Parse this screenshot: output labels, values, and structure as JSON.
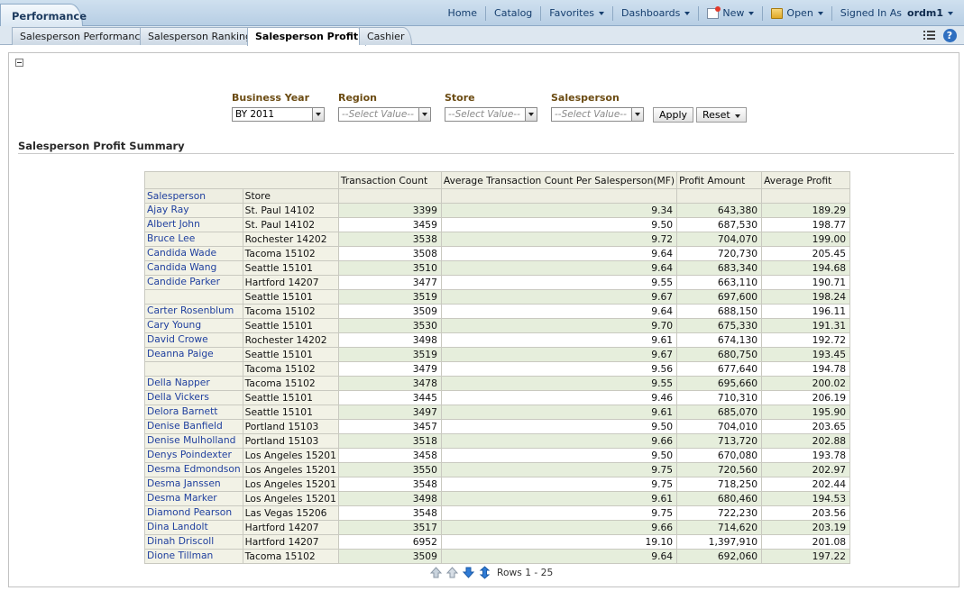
{
  "header": {
    "app_tab": "Performance",
    "nav": {
      "home": "Home",
      "catalog": "Catalog",
      "favorites": "Favorites",
      "dashboards": "Dashboards",
      "new": "New",
      "open": "Open",
      "signed_in_as": "Signed In As",
      "user": "ordm1"
    }
  },
  "tabs": [
    "Salesperson Performance",
    "Salesperson Ranking",
    "Salesperson Profit",
    "Cashier"
  ],
  "active_tab": "Salesperson Profit",
  "prompts": {
    "business_year": {
      "label": "Business Year",
      "value": "BY 2011"
    },
    "region": {
      "label": "Region",
      "placeholder": "--Select Value--"
    },
    "store": {
      "label": "Store",
      "placeholder": "--Select Value--"
    },
    "salesperson": {
      "label": "Salesperson",
      "placeholder": "--Select Value--"
    },
    "apply": "Apply",
    "reset": "Reset"
  },
  "report": {
    "title": "Salesperson Profit Summary",
    "columns": {
      "salesperson": "Salesperson",
      "store": "Store",
      "transaction_count": "Transaction Count",
      "avg_transaction": "Average Transaction Count Per Salesperson(MF)",
      "profit_amount": "Profit Amount",
      "average_profit": "Average Profit"
    },
    "rows": [
      {
        "salesperson": "Ajay Ray",
        "store": "St. Paul 14102",
        "txn": "3399",
        "avg_txn": "9.34",
        "profit": "643,380",
        "avg_profit": "189.29"
      },
      {
        "salesperson": "Albert John",
        "store": "St. Paul 14102",
        "txn": "3459",
        "avg_txn": "9.50",
        "profit": "687,530",
        "avg_profit": "198.77"
      },
      {
        "salesperson": "Bruce Lee",
        "store": "Rochester 14202",
        "txn": "3538",
        "avg_txn": "9.72",
        "profit": "704,070",
        "avg_profit": "199.00"
      },
      {
        "salesperson": "Candida Wade",
        "store": "Tacoma 15102",
        "txn": "3508",
        "avg_txn": "9.64",
        "profit": "720,730",
        "avg_profit": "205.45"
      },
      {
        "salesperson": "Candida Wang",
        "store": "Seattle 15101",
        "txn": "3510",
        "avg_txn": "9.64",
        "profit": "683,340",
        "avg_profit": "194.68"
      },
      {
        "salesperson": "Candide Parker",
        "store": "Hartford 14207",
        "txn": "3477",
        "avg_txn": "9.55",
        "profit": "663,110",
        "avg_profit": "190.71"
      },
      {
        "salesperson": "",
        "store": "Seattle 15101",
        "txn": "3519",
        "avg_txn": "9.67",
        "profit": "697,600",
        "avg_profit": "198.24"
      },
      {
        "salesperson": "Carter Rosenblum",
        "store": "Tacoma 15102",
        "txn": "3509",
        "avg_txn": "9.64",
        "profit": "688,150",
        "avg_profit": "196.11"
      },
      {
        "salesperson": "Cary Young",
        "store": "Seattle 15101",
        "txn": "3530",
        "avg_txn": "9.70",
        "profit": "675,330",
        "avg_profit": "191.31"
      },
      {
        "salesperson": "David Crowe",
        "store": "Rochester 14202",
        "txn": "3498",
        "avg_txn": "9.61",
        "profit": "674,130",
        "avg_profit": "192.72"
      },
      {
        "salesperson": "Deanna Paige",
        "store": "Seattle 15101",
        "txn": "3519",
        "avg_txn": "9.67",
        "profit": "680,750",
        "avg_profit": "193.45"
      },
      {
        "salesperson": "",
        "store": "Tacoma 15102",
        "txn": "3479",
        "avg_txn": "9.56",
        "profit": "677,640",
        "avg_profit": "194.78"
      },
      {
        "salesperson": "Della Napper",
        "store": "Tacoma 15102",
        "txn": "3478",
        "avg_txn": "9.55",
        "profit": "695,660",
        "avg_profit": "200.02"
      },
      {
        "salesperson": "Della Vickers",
        "store": "Seattle 15101",
        "txn": "3445",
        "avg_txn": "9.46",
        "profit": "710,310",
        "avg_profit": "206.19"
      },
      {
        "salesperson": "Delora Barnett",
        "store": "Seattle 15101",
        "txn": "3497",
        "avg_txn": "9.61",
        "profit": "685,070",
        "avg_profit": "195.90"
      },
      {
        "salesperson": "Denise Banfield",
        "store": "Portland 15103",
        "txn": "3457",
        "avg_txn": "9.50",
        "profit": "704,010",
        "avg_profit": "203.65"
      },
      {
        "salesperson": "Denise Mulholland",
        "store": "Portland 15103",
        "txn": "3518",
        "avg_txn": "9.66",
        "profit": "713,720",
        "avg_profit": "202.88"
      },
      {
        "salesperson": "Denys Poindexter",
        "store": "Los Angeles 15201",
        "txn": "3458",
        "avg_txn": "9.50",
        "profit": "670,080",
        "avg_profit": "193.78"
      },
      {
        "salesperson": "Desma Edmondson",
        "store": "Los Angeles 15201",
        "txn": "3550",
        "avg_txn": "9.75",
        "profit": "720,560",
        "avg_profit": "202.97"
      },
      {
        "salesperson": "Desma Janssen",
        "store": "Los Angeles 15201",
        "txn": "3548",
        "avg_txn": "9.75",
        "profit": "718,250",
        "avg_profit": "202.44"
      },
      {
        "salesperson": "Desma Marker",
        "store": "Los Angeles 15201",
        "txn": "3498",
        "avg_txn": "9.61",
        "profit": "680,460",
        "avg_profit": "194.53"
      },
      {
        "salesperson": "Diamond Pearson",
        "store": "Las Vegas 15206",
        "txn": "3548",
        "avg_txn": "9.75",
        "profit": "722,230",
        "avg_profit": "203.56"
      },
      {
        "salesperson": "Dina Landolt",
        "store": "Hartford 14207",
        "txn": "3517",
        "avg_txn": "9.66",
        "profit": "714,620",
        "avg_profit": "203.19"
      },
      {
        "salesperson": "Dinah Driscoll",
        "store": "Hartford 14207",
        "txn": "6952",
        "avg_txn": "19.10",
        "profit": "1,397,910",
        "avg_profit": "201.08"
      },
      {
        "salesperson": "Dione Tillman",
        "store": "Tacoma 15102",
        "txn": "3509",
        "avg_txn": "9.64",
        "profit": "692,060",
        "avg_profit": "197.22"
      }
    ],
    "pager_text": "Rows 1 - 25"
  },
  "icons": {
    "tab_menu": "list-menu-icon",
    "help": "help-icon",
    "pager": [
      "first-page-icon",
      "previous-page-icon",
      "next-page-icon",
      "all-pages-icon"
    ]
  },
  "colors": {
    "link": "#1f3f9e",
    "prompt_label": "#6b4b12",
    "header_bg": "#cfe0ef",
    "row_band": "#e6eedc"
  }
}
